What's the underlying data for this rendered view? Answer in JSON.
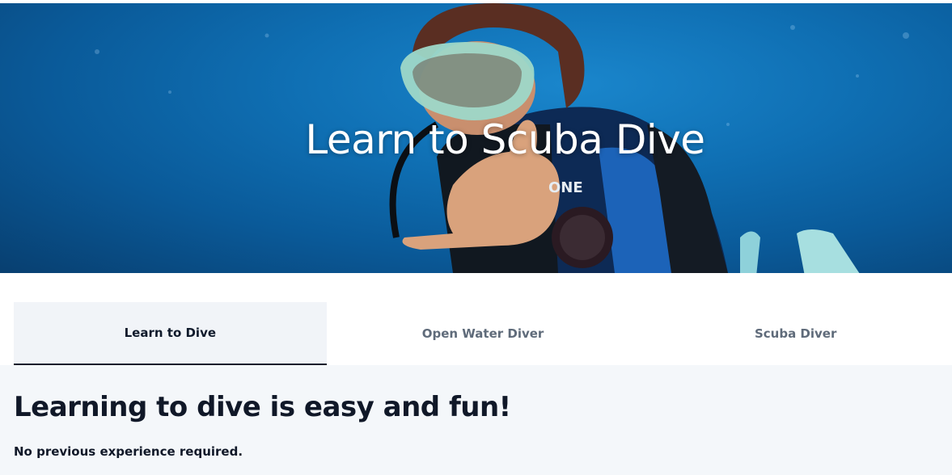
{
  "hero": {
    "title": "Learn to Scuba Dive",
    "image_alt": "diver-photo"
  },
  "tabs": [
    {
      "label": "Learn to Dive",
      "active": true
    },
    {
      "label": "Open Water Diver",
      "active": false
    },
    {
      "label": "Scuba Diver",
      "active": false
    }
  ],
  "content": {
    "heading": "Learning to dive is easy and fun!",
    "subtext": "No previous experience required."
  },
  "colors": {
    "ocean": "#0f6fb3",
    "active_tab_bg": "#f1f4f8",
    "active_tab_border": "#0f1a2b",
    "content_bg": "#f4f7fa",
    "heading": "#101828"
  }
}
